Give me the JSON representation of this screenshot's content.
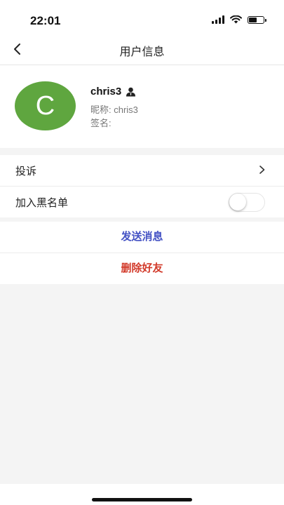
{
  "status_bar": {
    "time": "22:01"
  },
  "nav": {
    "title": "用户信息",
    "back_icon": "chevron-left-icon"
  },
  "profile": {
    "avatar_letter": "C",
    "avatar_color": "#5fa63f",
    "username": "chris3",
    "nickname_label": "昵称: chris3",
    "signature_label": "签名:"
  },
  "menu": {
    "complaint_label": "投诉",
    "blacklist_label": "加入黑名单",
    "blacklist_enabled": false
  },
  "actions": {
    "send_message_label": "发送消息",
    "send_message_color": "#4452c4",
    "delete_friend_label": "删除好友",
    "delete_friend_color": "#d23a2a"
  }
}
